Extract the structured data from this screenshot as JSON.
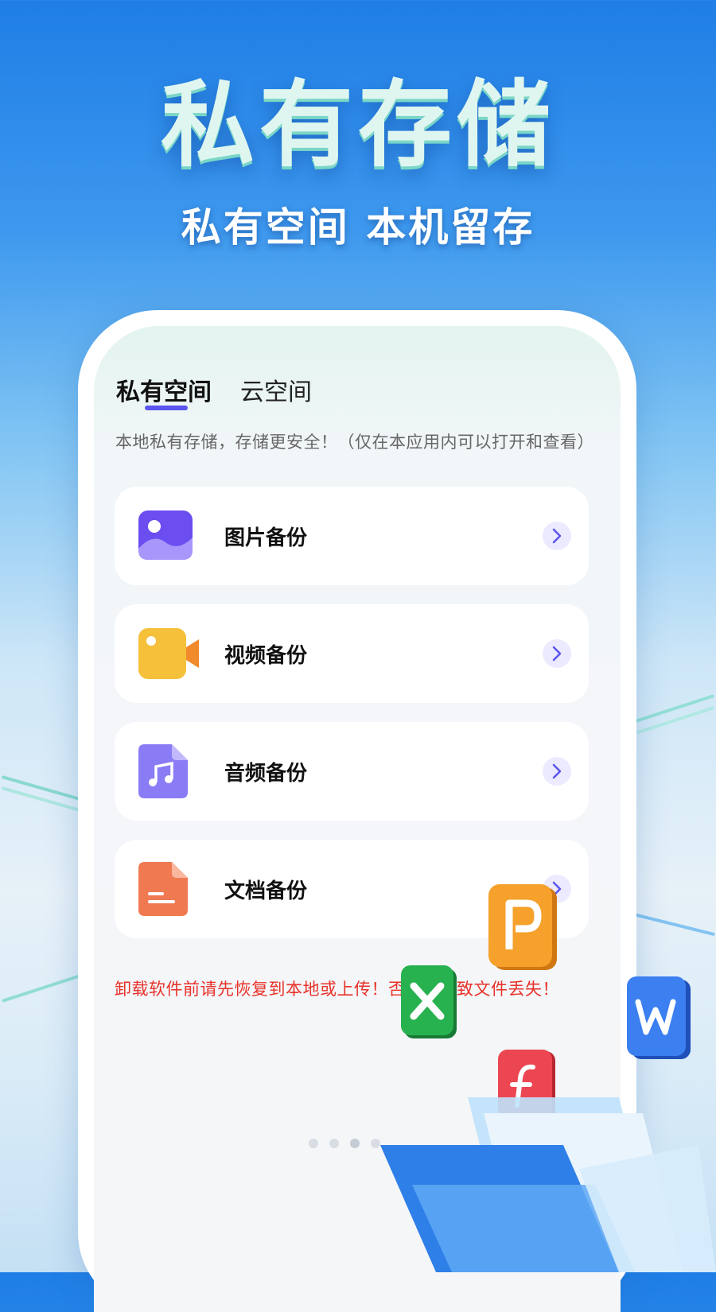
{
  "hero": {
    "title": "私有存储",
    "subtitle": "私有空间 本机留存"
  },
  "tabs": [
    {
      "label": "私有空间",
      "active": true
    },
    {
      "label": "云空间",
      "active": false
    }
  ],
  "tip": "本地私有存储，存储更安全！（仅在本应用内可以打开和查看）",
  "cards": [
    {
      "label": "图片备份",
      "icon": "image-icon"
    },
    {
      "label": "视频备份",
      "icon": "video-camera-icon"
    },
    {
      "label": "音频备份",
      "icon": "music-file-icon"
    },
    {
      "label": "文档备份",
      "icon": "document-file-icon"
    }
  ],
  "warning": "卸载软件前请先恢复到本地或上传！否则会导致文件丢失！",
  "pager": {
    "total": 4,
    "current": 3
  },
  "decor_icons": [
    {
      "name": "powerpoint-icon",
      "letter": "P",
      "color": "#f29a22"
    },
    {
      "name": "excel-icon",
      "letter": "X",
      "color": "#23a347"
    },
    {
      "name": "word-icon",
      "letter": "W",
      "color": "#2e6fe8"
    },
    {
      "name": "flash-icon",
      "letter": "f",
      "color": "#e8404a"
    }
  ],
  "colors": {
    "accent": "#5a55ee",
    "warning": "#e8322a",
    "background_top": "#1f7ee6"
  }
}
